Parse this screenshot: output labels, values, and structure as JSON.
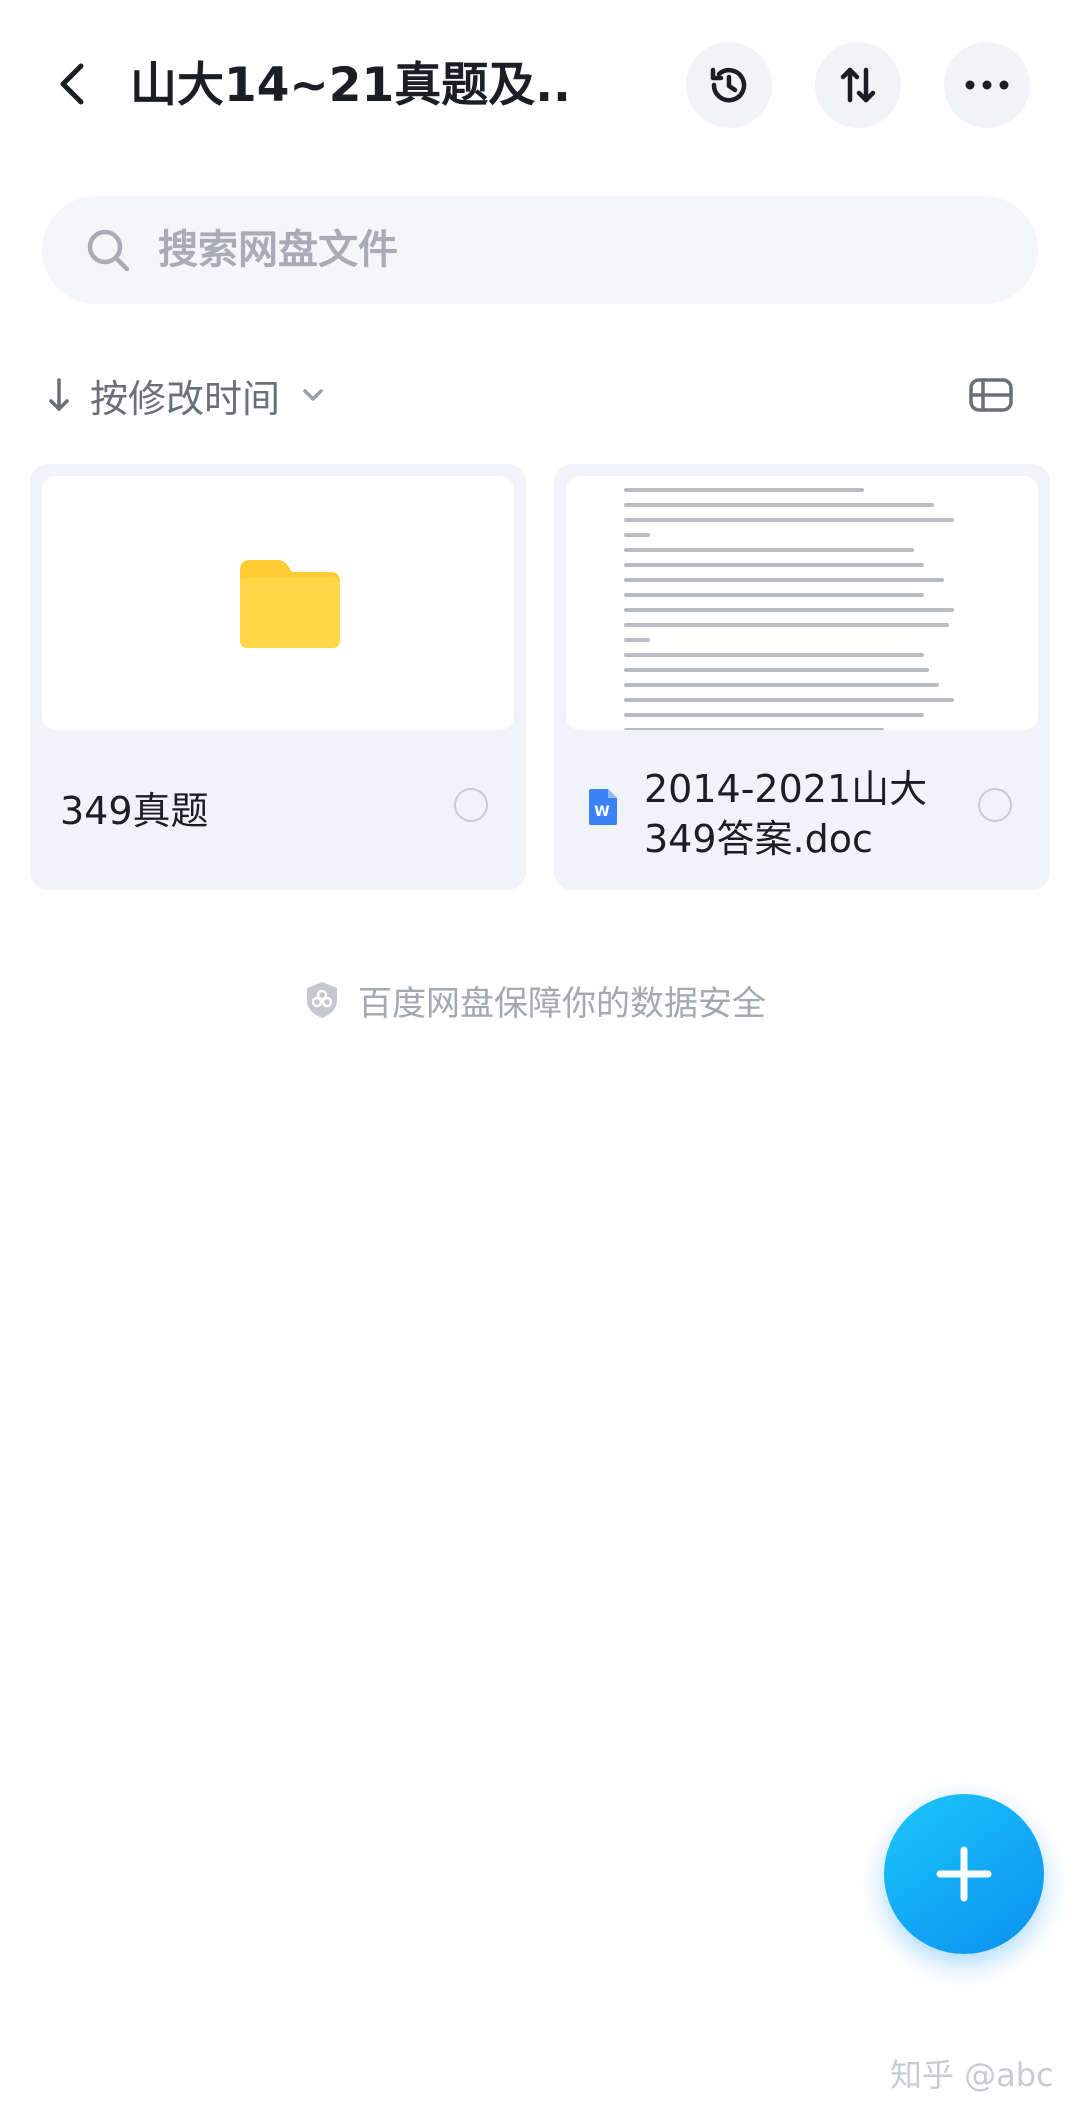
{
  "header": {
    "title": "山大14~21真题及...",
    "back_icon": "chevron-left-icon",
    "actions": [
      {
        "name": "history",
        "icon": "history-clock-icon"
      },
      {
        "name": "sort",
        "icon": "sort-arrows-icon"
      },
      {
        "name": "more",
        "icon": "more-dots-icon"
      }
    ]
  },
  "search": {
    "placeholder": "搜索网盘文件",
    "icon": "search-icon"
  },
  "sort": {
    "direction_icon": "arrow-down-icon",
    "label": "按修改时间",
    "dropdown_icon": "chevron-down-icon"
  },
  "view_toggle": {
    "icon": "list-view-icon"
  },
  "files": [
    {
      "type": "folder",
      "name": "349真题",
      "icon": "folder-icon",
      "selected": false
    },
    {
      "type": "doc",
      "name_line1": "2014-2021山大",
      "name_line2": "349答案.doc",
      "icon": "word-icon",
      "selected": false
    }
  ],
  "safety_note": {
    "icon": "shield-icon",
    "text": "百度网盘保障你的数据安全"
  },
  "fab": {
    "icon": "plus-icon"
  },
  "watermark": "知乎 @abc",
  "colors": {
    "accent": "#12a8f5",
    "folder": "#ffd43b",
    "word": "#3b82f6",
    "card_bg": "#f2f3f8",
    "search_bg": "#f5f6fa"
  }
}
